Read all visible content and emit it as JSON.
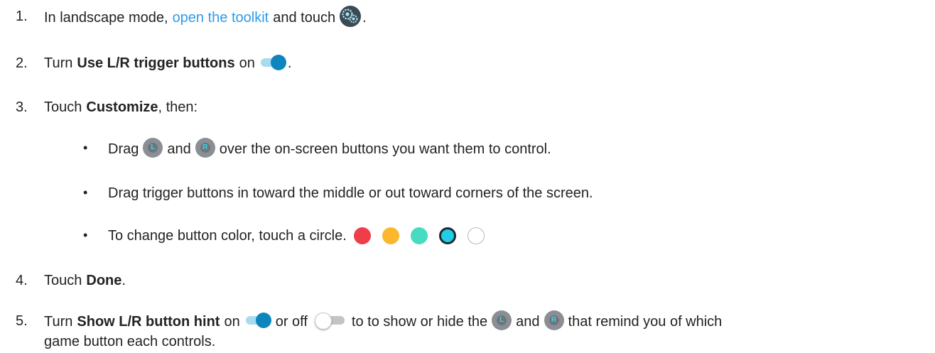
{
  "steps": [
    {
      "number": "1.",
      "text_before": "In landscape mode,",
      "link": "open the toolkit",
      "text_after": "and touch",
      "end": "."
    },
    {
      "number": "2.",
      "text_before": "Turn",
      "bold": "Use L/R trigger buttons",
      "text_after": "on",
      "end": "."
    },
    {
      "number": "3.",
      "text_before": "Touch",
      "bold": "Customize",
      "text_after": ", then:"
    },
    {
      "number": "4.",
      "text_before": "Touch",
      "bold": "Done",
      "end": "."
    },
    {
      "number": "5.",
      "text_before": "Turn",
      "bold": "Show L/R button hint",
      "text_on": "on",
      "text_off": "or off",
      "text_after": "to to show or hide the",
      "and": "and",
      "text_end": "that remind you of which",
      "line2": "game button each controls."
    }
  ],
  "bullets": [
    {
      "text_before": "Drag",
      "and": "and",
      "text_after": "over the on-screen buttons you want them to control."
    },
    {
      "text": "Drag trigger buttons in toward the middle or out toward corners of the screen."
    },
    {
      "text": "To change button color, touch a circle."
    }
  ],
  "bullet_char": "•",
  "trigger_labels": {
    "left": "L",
    "right": "R"
  },
  "icons": {
    "toolkit": "gear-settings-icon",
    "toggle_on": "toggle-on-icon",
    "toggle_off": "toggle-off-icon",
    "left_trigger": "l-trigger-icon",
    "right_trigger": "r-trigger-icon"
  },
  "colors": {
    "link": "#2e9be6",
    "toggle_on": "#0e86bd",
    "options": [
      "#ef3e4a",
      "#fbb82e",
      "#46dcc0",
      "#22cde8",
      "#ffffff"
    ],
    "selected_index": 3
  }
}
